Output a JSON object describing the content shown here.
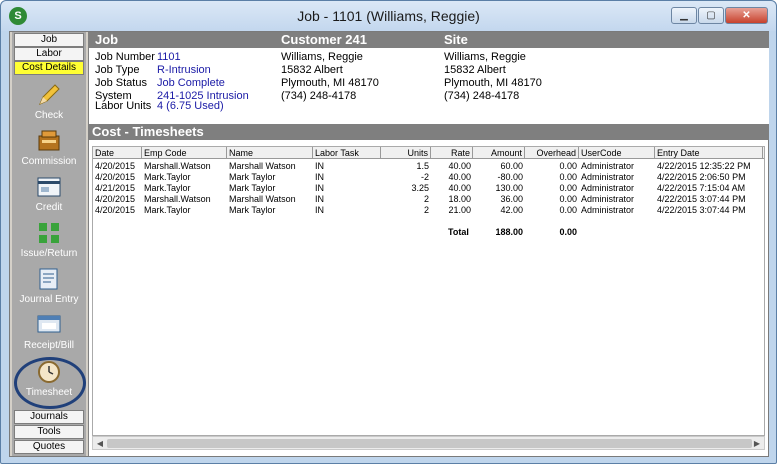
{
  "window": {
    "title": "Job - 1101 (Williams, Reggie)",
    "app_icon": "S"
  },
  "sidebar": {
    "tabs_top": [
      "Job",
      "Labor",
      "Cost Details"
    ],
    "active_tab": "Cost Details",
    "tools": [
      {
        "label": "Check",
        "icon": "pencil-icon"
      },
      {
        "label": "Commission",
        "icon": "cash-register-icon"
      },
      {
        "label": "Credit",
        "icon": "credit-card-icon"
      },
      {
        "label": "Issue/Return",
        "icon": "arrows-icon"
      },
      {
        "label": "Journal Entry",
        "icon": "journal-icon"
      },
      {
        "label": "Receipt/Bill",
        "icon": "receipt-icon"
      },
      {
        "label": "Timesheet",
        "icon": "clock-icon"
      }
    ],
    "tabs_bottom": [
      "Journals",
      "Tools",
      "Quotes"
    ]
  },
  "header": {
    "job": "Job",
    "customer": "Customer 241",
    "site": "Site"
  },
  "job_info": {
    "labels": [
      "Job Number",
      "Job Type",
      "Job Status",
      "System",
      "Labor Units"
    ],
    "values": [
      "1101",
      "R-Intrusion",
      "Job Complete",
      "241-1025 Intrusion",
      "4 (6.75 Used)"
    ]
  },
  "customer_info": [
    "Williams, Reggie",
    "15832 Albert",
    "Plymouth, MI  48170",
    "(734) 248-4178"
  ],
  "site_info": [
    "Williams, Reggie",
    "15832 Albert",
    "Plymouth, MI  48170",
    "(734) 248-4178"
  ],
  "section_title": "Cost - Timesheets",
  "table": {
    "columns": [
      "Date",
      "Emp Code",
      "Name",
      "Labor Task",
      "Units",
      "Rate",
      "Amount",
      "Overhead",
      "UserCode",
      "Entry Date"
    ],
    "rows": [
      [
        "4/20/2015",
        "Marshall.Watson",
        "Marshall Watson",
        "IN",
        "1.5",
        "40.00",
        "60.00",
        "0.00",
        "Administrator",
        "4/22/2015 12:35:22 PM"
      ],
      [
        "4/20/2015",
        "Mark.Taylor",
        "Mark Taylor",
        "IN",
        "-2",
        "40.00",
        "-80.00",
        "0.00",
        "Administrator",
        "4/22/2015 2:06:50 PM"
      ],
      [
        "4/21/2015",
        "Mark.Taylor",
        "Mark Taylor",
        "IN",
        "3.25",
        "40.00",
        "130.00",
        "0.00",
        "Administrator",
        "4/22/2015 7:15:04 AM"
      ],
      [
        "4/20/2015",
        "Marshall.Watson",
        "Marshall Watson",
        "IN",
        "2",
        "18.00",
        "36.00",
        "0.00",
        "Administrator",
        "4/22/2015 3:07:44 PM"
      ],
      [
        "4/20/2015",
        "Mark.Taylor",
        "Mark Taylor",
        "IN",
        "2",
        "21.00",
        "42.00",
        "0.00",
        "Administrator",
        "4/22/2015 3:07:44 PM"
      ]
    ],
    "totals": {
      "label": "Total",
      "amount": "188.00",
      "overhead": "0.00"
    }
  }
}
